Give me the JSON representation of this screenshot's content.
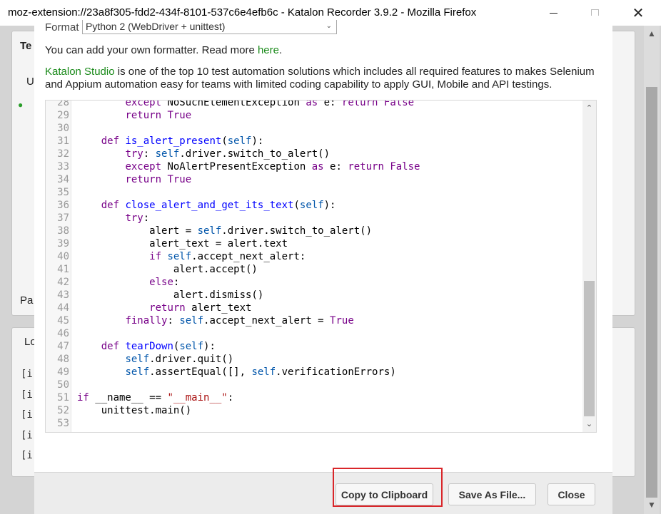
{
  "window": {
    "title": "moz-extension://23a8f305-fdd2-434f-8101-537c6e4efb6c - Katalon Recorder 3.9.2 - Mozilla Firefox",
    "minimize_icon": "minimize-icon",
    "maximize_icon": "maximize-icon",
    "close_icon": "close-icon",
    "close_glyph": "✕"
  },
  "background": {
    "header_partial": "Te",
    "row_partial_1": "U",
    "footer_partial": "Pa",
    "log_tab_partial": "Lo",
    "log_lines": [
      "[ir",
      "[ir",
      "[ir",
      "[ir",
      "[ir"
    ]
  },
  "dialog": {
    "format_label": "Format",
    "format_value": "Python 2 (WebDriver + unittest)",
    "add_formatter_text": "You can add your own formatter. Read more ",
    "add_formatter_link": "here",
    "add_formatter_suffix": ".",
    "promo_brand": "Katalon Studio",
    "promo_text": " is one of the top 10 test automation solutions which includes all required features to makes Selenium and Appium automation easy for teams with limited coding capability to apply GUI, Mobile and API testings.",
    "code_lines": [
      {
        "n": "28",
        "c": "        except NoSuchElementException as e: return False"
      },
      {
        "n": "29",
        "c": "        return True"
      },
      {
        "n": "30",
        "c": ""
      },
      {
        "n": "31",
        "c": "    def is_alert_present(self):"
      },
      {
        "n": "32",
        "c": "        try: self.driver.switch_to_alert()"
      },
      {
        "n": "33",
        "c": "        except NoAlertPresentException as e: return False"
      },
      {
        "n": "34",
        "c": "        return True"
      },
      {
        "n": "35",
        "c": ""
      },
      {
        "n": "36",
        "c": "    def close_alert_and_get_its_text(self):"
      },
      {
        "n": "37",
        "c": "        try:"
      },
      {
        "n": "38",
        "c": "            alert = self.driver.switch_to_alert()"
      },
      {
        "n": "39",
        "c": "            alert_text = alert.text"
      },
      {
        "n": "40",
        "c": "            if self.accept_next_alert:"
      },
      {
        "n": "41",
        "c": "                alert.accept()"
      },
      {
        "n": "42",
        "c": "            else:"
      },
      {
        "n": "43",
        "c": "                alert.dismiss()"
      },
      {
        "n": "44",
        "c": "            return alert_text"
      },
      {
        "n": "45",
        "c": "        finally: self.accept_next_alert = True"
      },
      {
        "n": "46",
        "c": ""
      },
      {
        "n": "47",
        "c": "    def tearDown(self):"
      },
      {
        "n": "48",
        "c": "        self.driver.quit()"
      },
      {
        "n": "49",
        "c": "        self.assertEqual([], self.verificationErrors)"
      },
      {
        "n": "50",
        "c": ""
      },
      {
        "n": "51",
        "c": "if __name__ == \"__main__\":"
      },
      {
        "n": "52",
        "c": "    unittest.main()"
      },
      {
        "n": "53",
        "c": ""
      }
    ],
    "buttons": {
      "copy": "Copy to Clipboard",
      "save": "Save As File...",
      "close": "Close"
    }
  },
  "colors": {
    "highlight": "#d9262a",
    "link": "#1a8a1a",
    "keyword": "#770088",
    "definition": "#0000ff",
    "self": "#0055aa",
    "string": "#aa1111"
  }
}
